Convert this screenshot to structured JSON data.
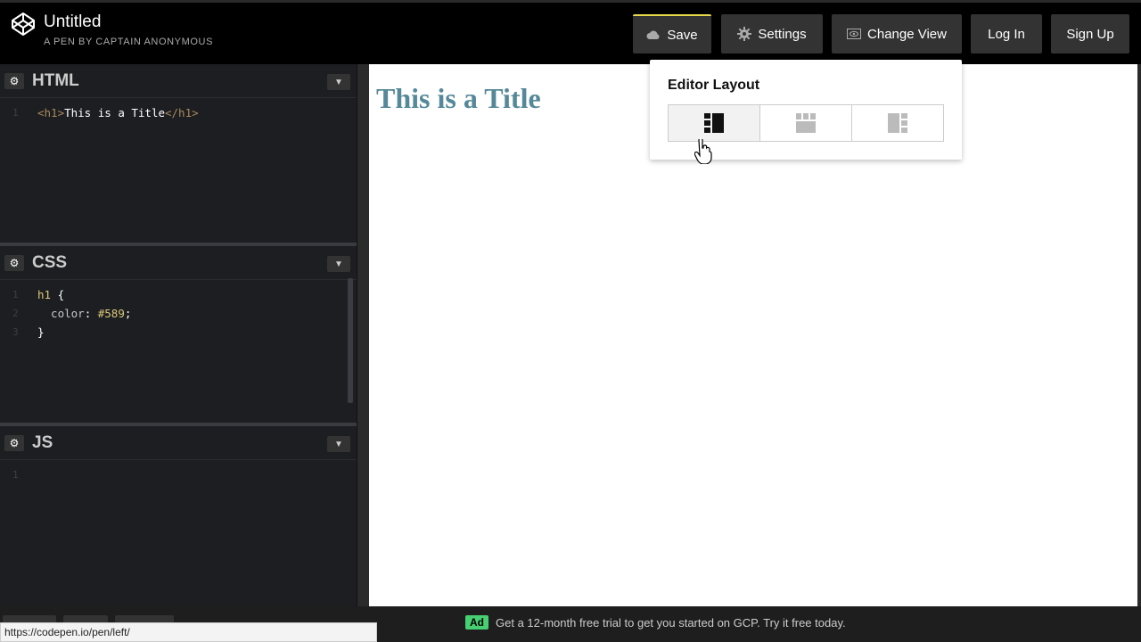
{
  "header": {
    "pen_title": "Untitled",
    "pen_subtitle": "A PEN BY CAPTAIN ANONYMOUS",
    "buttons": {
      "save": "Save",
      "settings": "Settings",
      "change_view": "Change View",
      "login": "Log In",
      "signup": "Sign Up"
    }
  },
  "editors": {
    "html": {
      "name": "HTML",
      "lines": [
        {
          "num": "1",
          "parts": [
            {
              "t": "<h1>",
              "c": "tag"
            },
            {
              "t": "This is a Title",
              "c": ""
            },
            {
              "t": "</h1>",
              "c": "tag"
            }
          ]
        }
      ]
    },
    "css": {
      "name": "CSS",
      "lines": [
        {
          "num": "1",
          "parts": [
            {
              "t": "h1",
              "c": "sel"
            },
            {
              "t": " {",
              "c": ""
            }
          ]
        },
        {
          "num": "2",
          "parts": [
            {
              "t": "  color",
              "c": "prop"
            },
            {
              "t": ": ",
              "c": ""
            },
            {
              "t": "#589",
              "c": "num"
            },
            {
              "t": ";",
              "c": ""
            }
          ]
        },
        {
          "num": "3",
          "parts": [
            {
              "t": "}",
              "c": ""
            }
          ]
        }
      ]
    },
    "js": {
      "name": "JS",
      "lines": [
        {
          "num": "1",
          "parts": []
        }
      ]
    }
  },
  "preview": {
    "h1": "This is a Title",
    "h1_color": "#558899"
  },
  "popup": {
    "title": "Editor Layout",
    "options": [
      "layout-left-icon",
      "layout-top-icon",
      "layout-right-icon"
    ],
    "active_index": 0
  },
  "footer": {
    "ad_badge": "Ad",
    "ad_text": "Get a 12-month free trial to get you started on GCP. Try it free today."
  },
  "status_url": "https://codepen.io/pen/left/",
  "colors": {
    "accent_save": "#e6d84a",
    "ad_green": "#47cf73"
  }
}
